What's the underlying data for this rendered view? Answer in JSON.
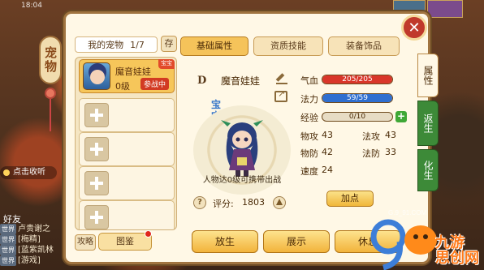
{
  "status_bar": {
    "time": "18:04"
  },
  "panel": {
    "vertical_title": "宠物"
  },
  "pet_list": {
    "header_label": "我的宠物",
    "header_count": "1/7",
    "store_label": "存",
    "pets": [
      {
        "name": "魔音娃娃",
        "level": "0级",
        "badge": "参战中",
        "corner": "宝宝"
      }
    ],
    "empty_slots": 4
  },
  "tabs": [
    {
      "label": "基础属性",
      "active": true
    },
    {
      "label": "资质技能",
      "active": false
    },
    {
      "label": "装备饰品",
      "active": false
    }
  ],
  "side_tabs": [
    {
      "label": "属性",
      "active": true
    },
    {
      "label": "返生",
      "active": false
    },
    {
      "label": "化生",
      "active": false
    }
  ],
  "pet_detail": {
    "grade": "D",
    "name": "魔音娃娃",
    "type_label": "宝宝",
    "hint": "人物达0级可携带出战",
    "score_label": "评分:",
    "score_value": "1803"
  },
  "stats": {
    "hp": {
      "label": "气血",
      "text": "205/205",
      "ratio": 1.0,
      "color": "#d9362a"
    },
    "mp": {
      "label": "法力",
      "text": "59/59",
      "ratio": 1.0,
      "color": "#2f6fd0"
    },
    "exp": {
      "label": "经验",
      "text": "0/10",
      "ratio": 0.0,
      "color": "#f0c02c"
    },
    "attrs": [
      {
        "label": "物攻",
        "value": "43"
      },
      {
        "label": "法攻",
        "value": "43"
      },
      {
        "label": "物防",
        "value": "42"
      },
      {
        "label": "法防",
        "value": "33"
      },
      {
        "label": "速度",
        "value": "24"
      }
    ],
    "add_point_label": "加点"
  },
  "bottom_buttons": {
    "strategy_label": "攻略",
    "codex_label": "图鉴",
    "release_label": "放生",
    "show_label": "展示",
    "rest_label": "休息"
  },
  "background": {
    "click_record": "点击收听",
    "friends_label": "好友",
    "chat_lines": [
      {
        "tag": "世界",
        "text": "卢贵谢之"
      },
      {
        "tag": "世界",
        "text": "[梅精]"
      },
      {
        "tag": "世界",
        "text": "[蓝紫凯林"
      },
      {
        "tag": "世界",
        "text": "[游戏]"
      }
    ]
  },
  "watermark": {
    "url": "G.9_91.COM",
    "text": "九游 思创网"
  }
}
